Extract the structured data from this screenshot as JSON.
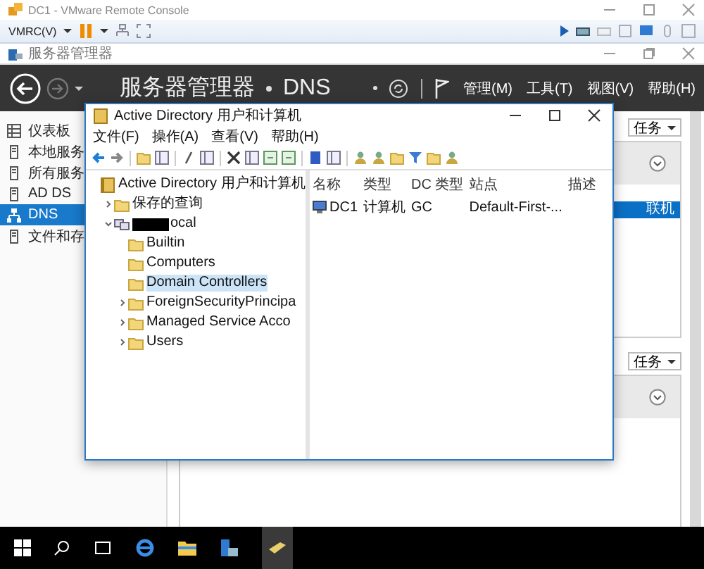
{
  "vmware": {
    "title": "DC1 - VMware Remote Console",
    "menu_label": "VMRC(V)"
  },
  "server_manager": {
    "window_title": "服务器管理器",
    "app_name": "服务器管理器",
    "page": "DNS",
    "menus": [
      "管理(M)",
      "工具(T)",
      "视图(V)",
      "帮助(H)"
    ],
    "sidebar": {
      "items": [
        {
          "label": "仪表板",
          "selected": false
        },
        {
          "label": "本地服务",
          "selected": false
        },
        {
          "label": "所有服务",
          "selected": false
        },
        {
          "label": "AD DS",
          "selected": false
        },
        {
          "label": "DNS",
          "selected": true
        },
        {
          "label": "文件和存",
          "selected": false
        }
      ]
    },
    "sections": [
      {
        "tasks_label": "任务",
        "rows": [
          {
            "text": "联机",
            "selected": true
          }
        ]
      },
      {
        "tasks_label": "任务"
      }
    ]
  },
  "aduc_window": {
    "title": "Active Directory 用户和计算机",
    "menus": [
      "文件(F)",
      "操作(A)",
      "查看(V)",
      "帮助(H)"
    ],
    "tree": [
      {
        "label": "Active Directory 用户和计算机",
        "kind": "root",
        "selected": false,
        "children": [
          {
            "label": "保存的查询",
            "kind": "folder",
            "expanded": false,
            "selected": false
          },
          {
            "label": "ocal",
            "kind": "domain",
            "redacted": true,
            "expanded": true,
            "selected": false,
            "children": [
              {
                "label": "Builtin",
                "kind": "folder",
                "selected": false
              },
              {
                "label": "Computers",
                "kind": "folder",
                "selected": false
              },
              {
                "label": "Domain Controllers",
                "kind": "folder",
                "selected": true
              },
              {
                "label": "ForeignSecurityPrincipa",
                "kind": "folder",
                "expanded": false,
                "selected": false
              },
              {
                "label": "Managed Service Acco",
                "kind": "folder",
                "expanded": false,
                "selected": false
              },
              {
                "label": "Users",
                "kind": "folder",
                "expanded": false,
                "selected": false
              }
            ]
          }
        ]
      }
    ],
    "columns": [
      "名称",
      "类型",
      "DC 类型",
      "站点",
      "描述"
    ],
    "rows": [
      {
        "cells": [
          "DC1",
          "计算机",
          "GC",
          "Default-First-...",
          ""
        ]
      }
    ]
  }
}
